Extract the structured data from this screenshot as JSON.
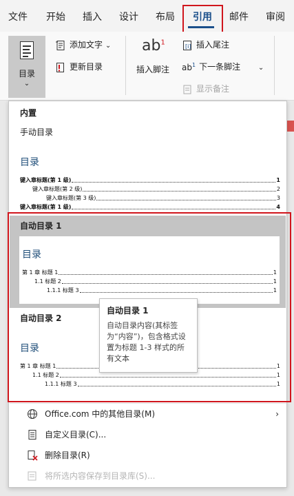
{
  "tabs": [
    {
      "label": "文件",
      "active": false
    },
    {
      "label": "开始",
      "active": false
    },
    {
      "label": "插入",
      "active": false
    },
    {
      "label": "设计",
      "active": false
    },
    {
      "label": "布局",
      "active": false
    },
    {
      "label": "引用",
      "active": true
    },
    {
      "label": "邮件",
      "active": false
    },
    {
      "label": "审阅",
      "active": false
    }
  ],
  "ribbon": {
    "toc_label": "目录",
    "add_text": "添加文字",
    "update_toc": "更新目录",
    "footnote_glyph": "ab",
    "footnote_sup": "1",
    "insert_footnote": "插入脚注",
    "insert_endnote": "插入尾注",
    "next_footnote_glyph": "ab",
    "next_footnote_sup": "1",
    "next_footnote": "下一条脚注",
    "show_notes": "显示备注"
  },
  "gallery": {
    "section_builtin": "内置",
    "manual_title": "手动目录",
    "manual_preview": {
      "heading": "目录",
      "lines": [
        {
          "text": "键入章标题(第 1 级)",
          "page": "1",
          "level": 1
        },
        {
          "text": "键入章标题(第 2 级)",
          "page": "2",
          "level": 2
        },
        {
          "text": "键入章标题(第 3 级)",
          "page": "3",
          "level": 3
        },
        {
          "text": "键入章标题(第 1 级)",
          "page": "4",
          "level": 1
        }
      ]
    },
    "auto1_title": "自动目录 1",
    "auto1_preview": {
      "heading": "目录",
      "lines": [
        {
          "text": "第 1 章 标题 1",
          "page": "1",
          "level": 1
        },
        {
          "text": "1.1 标题 2",
          "page": "1",
          "level": 2
        },
        {
          "text": "1.1.1 标题 3",
          "page": "1",
          "level": 3
        }
      ]
    },
    "auto2_title": "自动目录 2",
    "auto2_preview": {
      "heading": "目录",
      "lines": [
        {
          "text": "第 1 章 标题 1",
          "page": "1",
          "level": 1
        },
        {
          "text": "1.1 标题 2",
          "page": "1",
          "level": 2
        },
        {
          "text": "1.1.1 标题 3",
          "page": "1",
          "level": 3
        }
      ]
    }
  },
  "tooltip": {
    "title": "自动目录 1",
    "body": "自动目录内容(其标签为“内容”)，包含格式设置为标题 1-3 样式的所有文本"
  },
  "menu": {
    "more_toc": "Office.com 中的其他目录(M)",
    "custom_toc": "自定义目录(C)...",
    "remove_toc": "删除目录(R)",
    "save_selection": "将所选内容保存到目录库(S)..."
  },
  "colors": {
    "accent": "#1a4f8b",
    "highlight_box": "#d0151c",
    "toc_heading": "#1f4e79"
  }
}
